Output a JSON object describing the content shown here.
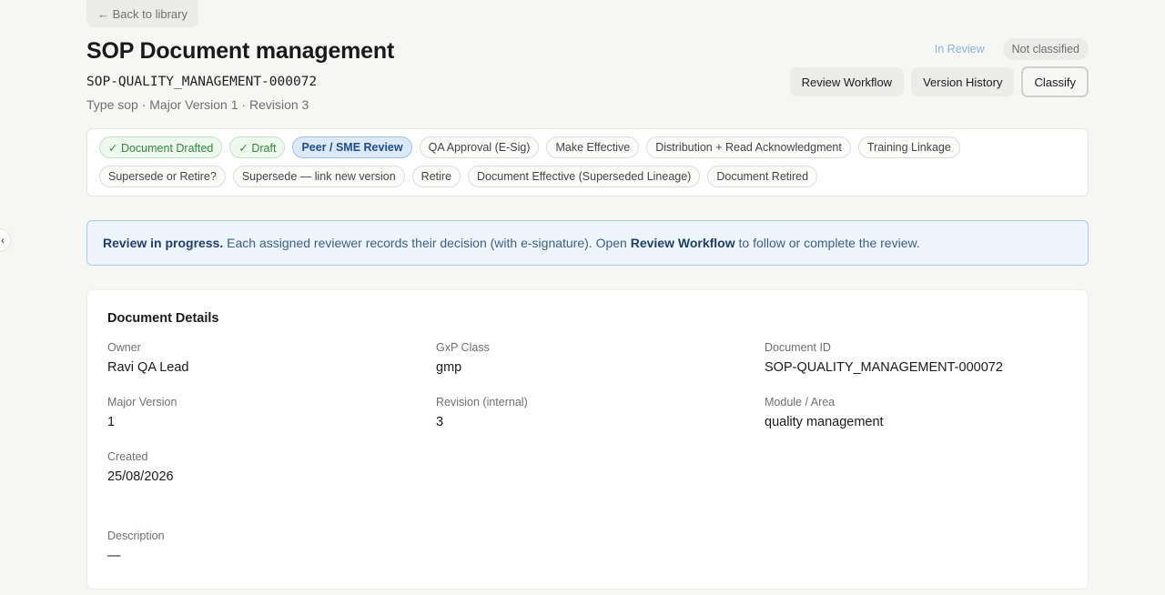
{
  "nav": {
    "back_label": "← Back to library"
  },
  "document": {
    "title": "SOP Document management",
    "code": "SOP-QUALITY_MANAGEMENT-000072",
    "meta": "Type sop · Major Version 1 · Revision 3"
  },
  "status": {
    "review": "In Review",
    "classification": "Not classified"
  },
  "actions": {
    "review_workflow": "Review Workflow",
    "version_history": "Version History",
    "classify": "Classify"
  },
  "workflow": {
    "steps": [
      {
        "label": "✓ Document Drafted",
        "state": "done"
      },
      {
        "label": "✓ Draft",
        "state": "done"
      },
      {
        "label": "Peer / SME Review",
        "state": "current"
      },
      {
        "label": "QA Approval (E-Sig)",
        "state": "pending"
      },
      {
        "label": "Make Effective",
        "state": "pending"
      },
      {
        "label": "Distribution + Read Acknowledgment",
        "state": "pending"
      },
      {
        "label": "Training Linkage",
        "state": "pending"
      },
      {
        "label": "Supersede or Retire?",
        "state": "pending"
      },
      {
        "label": "Supersede — link new version",
        "state": "pending"
      },
      {
        "label": "Retire",
        "state": "pending"
      },
      {
        "label": "Document Effective (Superseded Lineage)",
        "state": "pending"
      },
      {
        "label": "Document Retired",
        "state": "pending"
      }
    ]
  },
  "banner": {
    "strong": "Review in progress.",
    "text1": " Each assigned reviewer records their decision (with e-signature). Open ",
    "link": "Review Workflow",
    "text2": " to follow or complete the review."
  },
  "details": {
    "title": "Document Details",
    "owner": {
      "label": "Owner",
      "value": "Ravi QA Lead"
    },
    "gxp_class": {
      "label": "GxP Class",
      "value": "gmp"
    },
    "document_id": {
      "label": "Document ID",
      "value": "SOP-QUALITY_MANAGEMENT-000072"
    },
    "major_version": {
      "label": "Major Version",
      "value": "1"
    },
    "revision": {
      "label": "Revision (internal)",
      "value": "3"
    },
    "module": {
      "label": "Module / Area",
      "value": "quality management"
    },
    "created": {
      "label": "Created",
      "value": "25/08/2026"
    },
    "description": {
      "label": "Description",
      "value": "—"
    }
  },
  "icons": {
    "collapse": "chevron-left-icon"
  },
  "colors": {
    "background": "#f6f6f4",
    "done_step": "#2f8a3b",
    "current_step": "#1f4c8f",
    "banner_border": "#a9c9ee",
    "in_review_text": "#8ab4d8"
  }
}
